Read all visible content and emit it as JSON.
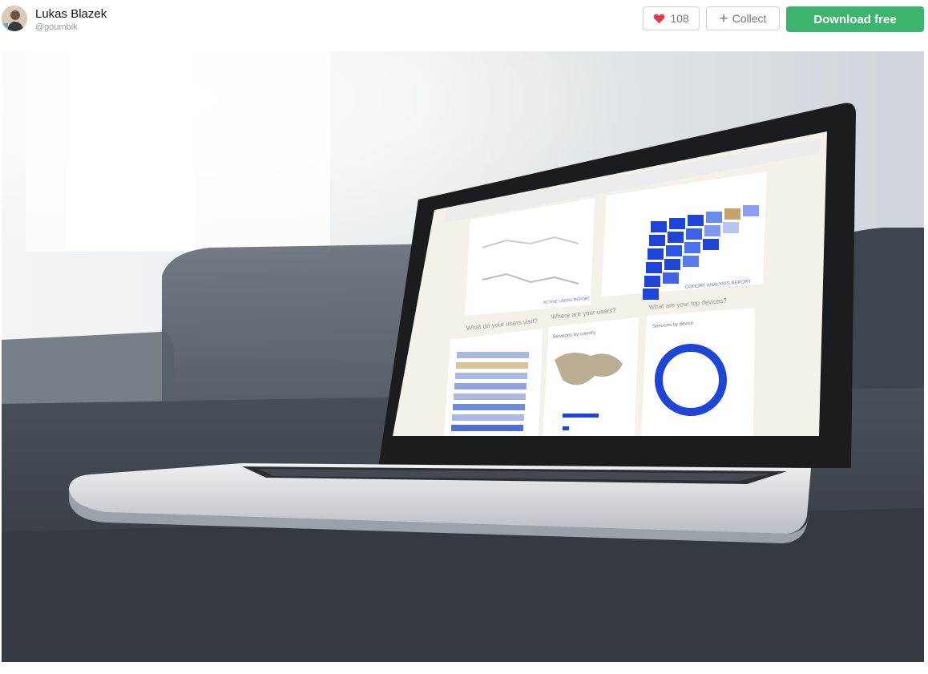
{
  "author": {
    "name": "Lukas Blazek",
    "handle": "@goumbik"
  },
  "actions": {
    "like_count": "108",
    "collect_label": "Collect",
    "download_label": "Download free"
  },
  "screen": {
    "q1": "What do your users visit?",
    "q2": "Where are your users?",
    "q3": "What are your top devices?",
    "sessions_country": "Sessions by country",
    "sessions_device": "Sessions by device",
    "cohort_link": "COHORT ANALYSIS REPORT",
    "user_link": "ACTIVE USERS REPORT"
  },
  "colors": {
    "accent": "#3cb46e",
    "heart": "#e8384f",
    "chart_blue": "#1e44d8"
  }
}
